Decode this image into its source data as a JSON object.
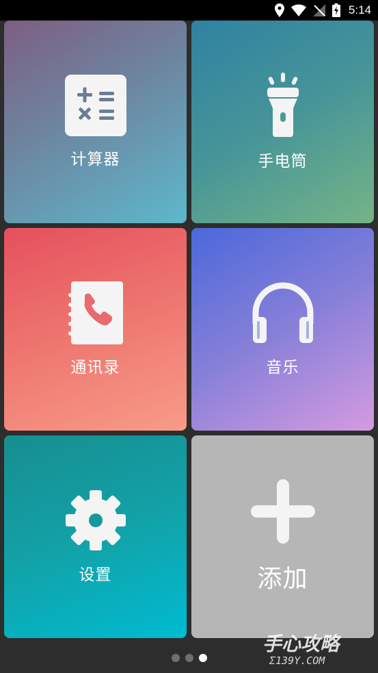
{
  "status_bar": {
    "time": "5:14",
    "icons": [
      "location-icon",
      "wifi-icon",
      "no-signal-icon",
      "battery-charging-icon"
    ]
  },
  "tiles": [
    {
      "label": "计算器",
      "icon": "calculator-icon",
      "colors": [
        "#7d5e83",
        "#5db8cb"
      ]
    },
    {
      "label": "手电筒",
      "icon": "flashlight-icon",
      "colors": [
        "#2f82a1",
        "#75b486"
      ]
    },
    {
      "label": "通讯录",
      "icon": "contacts-book-icon",
      "colors": [
        "#e5505d",
        "#f89b88"
      ]
    },
    {
      "label": "音乐",
      "icon": "headphones-icon",
      "colors": [
        "#4b68da",
        "#d59ae0"
      ]
    },
    {
      "label": "设置",
      "icon": "gear-icon",
      "colors": [
        "#178e8f",
        "#00bbd1"
      ]
    },
    {
      "label": "添加",
      "icon": "plus-icon",
      "colors": [
        "#b6b6b6"
      ]
    }
  ],
  "pager": {
    "pages": 3,
    "active_page": 3
  },
  "watermark": {
    "brand": "手心攻略",
    "domain": "Σ139Y.COM"
  }
}
